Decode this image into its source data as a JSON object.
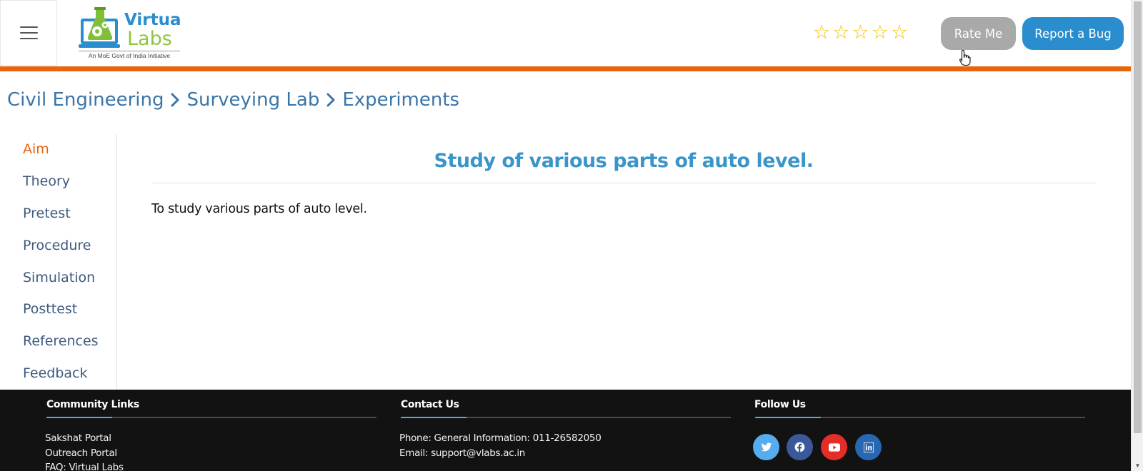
{
  "header": {
    "logo": {
      "top_text": "Virtual",
      "bottom_text": "Labs",
      "subtitle": "An MoE Govt of India Initiative"
    },
    "rating": {
      "stars_filled": 0,
      "stars_total": 5
    },
    "rate_button": "Rate Me",
    "bug_button": "Report a Bug"
  },
  "breadcrumb": [
    "Civil Engineering",
    "Surveying Lab",
    "Experiments"
  ],
  "sidebar": {
    "items": [
      {
        "label": "Aim",
        "active": true
      },
      {
        "label": "Theory",
        "active": false
      },
      {
        "label": "Pretest",
        "active": false
      },
      {
        "label": "Procedure",
        "active": false
      },
      {
        "label": "Simulation",
        "active": false
      },
      {
        "label": "Posttest",
        "active": false
      },
      {
        "label": "References",
        "active": false
      },
      {
        "label": "Feedback",
        "active": false
      }
    ]
  },
  "main": {
    "title": "Study of various parts of auto level.",
    "body": "To study various parts of auto level."
  },
  "footer": {
    "community": {
      "heading": "Community Links",
      "links": [
        "Sakshat Portal",
        "Outreach Portal",
        "FAQ: Virtual Labs"
      ]
    },
    "contact": {
      "heading": "Contact Us",
      "phone": "Phone: General Information: 011-26582050",
      "email": "Email: support@vlabs.ac.in"
    },
    "follow": {
      "heading": "Follow Us",
      "icons": [
        "twitter-icon",
        "facebook-icon",
        "youtube-icon",
        "linkedin-icon"
      ]
    }
  },
  "colors": {
    "accent_orange": "#e8650f",
    "link_blue": "#3a75a8",
    "title_blue": "#3b95c8",
    "bug_button": "#2a8dcd",
    "rate_button": "#a9a9a9",
    "footer_bg": "#121212",
    "twitter": "#55acee",
    "facebook": "#3b5998",
    "youtube": "#e52d27",
    "linkedin": "#2867b2"
  }
}
